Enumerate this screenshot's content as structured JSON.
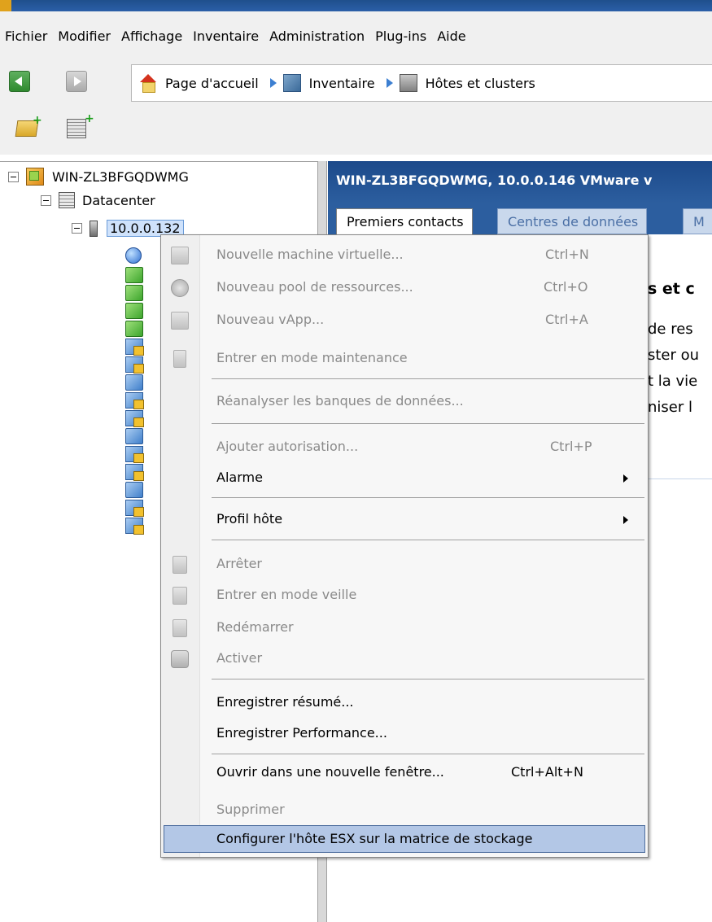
{
  "menubar": {
    "items": [
      "Fichier",
      "Modifier",
      "Affichage",
      "Inventaire",
      "Administration",
      "Plug-ins",
      "Aide"
    ]
  },
  "breadcrumb": {
    "items": [
      "Page d'accueil",
      "Inventaire",
      "Hôtes et clusters"
    ]
  },
  "tree": {
    "root": "WIN-ZL3BFGQDWMG",
    "datacenter": "Datacenter",
    "host": "10.0.0.132"
  },
  "right_pane": {
    "header": "WIN-ZL3BFGQDWMG, 10.0.0.146 VMware v",
    "tabs": [
      "Premiers contacts",
      "Centres de données",
      "M"
    ],
    "content_title": "s et c",
    "content_lines": [
      "de res",
      "ster ou",
      "t la vie",
      "niser l"
    ]
  },
  "context_menu": {
    "items": [
      {
        "label": "Nouvelle machine virtuelle...",
        "shortcut": "Ctrl+N"
      },
      {
        "label": "Nouveau pool de ressources...",
        "shortcut": "Ctrl+O"
      },
      {
        "label": "Nouveau vApp...",
        "shortcut": "Ctrl+A"
      },
      {
        "label": "Entrer en mode maintenance",
        "shortcut": ""
      },
      {
        "label": "Réanalyser les banques de données...",
        "shortcut": ""
      },
      {
        "label": "Ajouter autorisation...",
        "shortcut": "Ctrl+P"
      },
      {
        "label": "Alarme",
        "shortcut": ""
      },
      {
        "label": "Profil hôte",
        "shortcut": ""
      },
      {
        "label": "Arrêter",
        "shortcut": ""
      },
      {
        "label": "Entrer en mode veille",
        "shortcut": ""
      },
      {
        "label": "Redémarrer",
        "shortcut": ""
      },
      {
        "label": "Activer",
        "shortcut": ""
      },
      {
        "label": "Enregistrer résumé...",
        "shortcut": ""
      },
      {
        "label": "Enregistrer Performance...",
        "shortcut": ""
      },
      {
        "label": "Ouvrir dans une nouvelle fenêtre...",
        "shortcut": "Ctrl+Alt+N"
      },
      {
        "label": "Supprimer",
        "shortcut": ""
      },
      {
        "label": "Configurer l'hôte ESX sur la matrice de stockage",
        "shortcut": ""
      }
    ]
  }
}
